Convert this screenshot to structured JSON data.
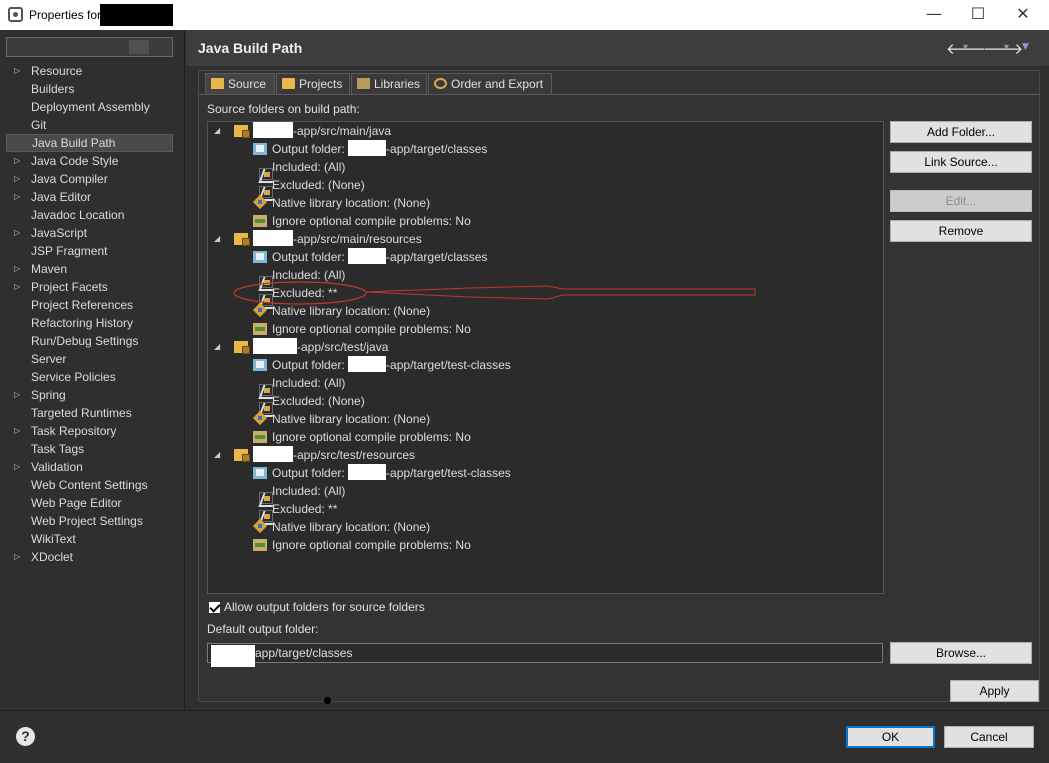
{
  "window": {
    "title": "Properties for",
    "min_glyph": "—",
    "max_glyph": "☐",
    "close_glyph": "✕"
  },
  "nav": {
    "items": [
      {
        "label": "Resource",
        "expandable": true
      },
      {
        "label": "Builders",
        "expandable": false
      },
      {
        "label": "Deployment Assembly",
        "expandable": false
      },
      {
        "label": "Git",
        "expandable": false
      },
      {
        "label": "Java Build Path",
        "expandable": false,
        "selected": true
      },
      {
        "label": "Java Code Style",
        "expandable": true
      },
      {
        "label": "Java Compiler",
        "expandable": true
      },
      {
        "label": "Java Editor",
        "expandable": true
      },
      {
        "label": "Javadoc Location",
        "expandable": false
      },
      {
        "label": "JavaScript",
        "expandable": true
      },
      {
        "label": "JSP Fragment",
        "expandable": false
      },
      {
        "label": "Maven",
        "expandable": true
      },
      {
        "label": "Project Facets",
        "expandable": true
      },
      {
        "label": "Project References",
        "expandable": false
      },
      {
        "label": "Refactoring History",
        "expandable": false
      },
      {
        "label": "Run/Debug Settings",
        "expandable": false
      },
      {
        "label": "Server",
        "expandable": false
      },
      {
        "label": "Service Policies",
        "expandable": false
      },
      {
        "label": "Spring",
        "expandable": true
      },
      {
        "label": "Targeted Runtimes",
        "expandable": false
      },
      {
        "label": "Task Repository",
        "expandable": true
      },
      {
        "label": "Task Tags",
        "expandable": false
      },
      {
        "label": "Validation",
        "expandable": true
      },
      {
        "label": "Web Content Settings",
        "expandable": false
      },
      {
        "label": "Web Page Editor",
        "expandable": false
      },
      {
        "label": "Web Project Settings",
        "expandable": false
      },
      {
        "label": "WikiText",
        "expandable": false
      },
      {
        "label": "XDoclet",
        "expandable": true
      }
    ]
  },
  "header": {
    "title": "Java Build Path",
    "back_glyph": "🡐",
    "forward_glyph": "🡒",
    "dropdown_glyph": "▾",
    "menu_glyph": "▼"
  },
  "tabs": [
    "Source",
    "Projects",
    "Libraries",
    "Order and Export"
  ],
  "source": {
    "heading": "Source folders on build path:",
    "folders": [
      {
        "path": "-app/src/main/java",
        "children": [
          {
            "icon": "outfolder",
            "prefix": "Output folder: ",
            "text": "-app/target/classes",
            "redact": true
          },
          {
            "icon": "filter",
            "text": "Included: (All)"
          },
          {
            "icon": "filter",
            "text": "Excluded: (None)"
          },
          {
            "icon": "native",
            "text": "Native library location: (None)"
          },
          {
            "icon": "ignore",
            "text": "Ignore optional compile problems: No"
          }
        ]
      },
      {
        "path": "-app/src/main/resources",
        "children": [
          {
            "icon": "outfolder",
            "prefix": "Output folder: ",
            "text": "-app/target/classes",
            "redact": true
          },
          {
            "icon": "filter",
            "text": "Included: (All)"
          },
          {
            "icon": "filter",
            "text": "Excluded: **"
          },
          {
            "icon": "native",
            "text": "Native library location: (None)"
          },
          {
            "icon": "ignore",
            "text": "Ignore optional compile problems: No"
          }
        ]
      },
      {
        "path": "-app/src/test/java",
        "children": [
          {
            "icon": "outfolder",
            "prefix": "Output folder: ",
            "text": "-app/target/test-classes",
            "redact": true
          },
          {
            "icon": "filter",
            "text": "Included: (All)"
          },
          {
            "icon": "filter",
            "text": "Excluded: (None)"
          },
          {
            "icon": "native",
            "text": "Native library location: (None)"
          },
          {
            "icon": "ignore",
            "text": "Ignore optional compile problems: No"
          }
        ]
      },
      {
        "path": "-app/src/test/resources",
        "children": [
          {
            "icon": "outfolder",
            "prefix": "Output folder: ",
            "text": "-app/target/test-classes",
            "redact": true
          },
          {
            "icon": "filter",
            "text": "Included: (All)"
          },
          {
            "icon": "filter",
            "text": "Excluded: **"
          },
          {
            "icon": "native",
            "text": "Native library location: (None)"
          },
          {
            "icon": "ignore",
            "text": "Ignore optional compile problems: No"
          }
        ]
      }
    ],
    "buttons": {
      "add_folder": "Add Folder...",
      "link_source": "Link Source...",
      "edit": "Edit...",
      "remove": "Remove"
    },
    "allow_output_label": "Allow output folders for source folders",
    "allow_output_checked": true,
    "default_output_label": "Default output folder:",
    "default_output_value": "app/target/classes",
    "browse": "Browse..."
  },
  "footer": {
    "apply": "Apply",
    "ok": "OK",
    "cancel": "Cancel",
    "help_glyph": "?"
  },
  "colors": {
    "annotation": "#c0392b",
    "accent": "#0078d7"
  }
}
